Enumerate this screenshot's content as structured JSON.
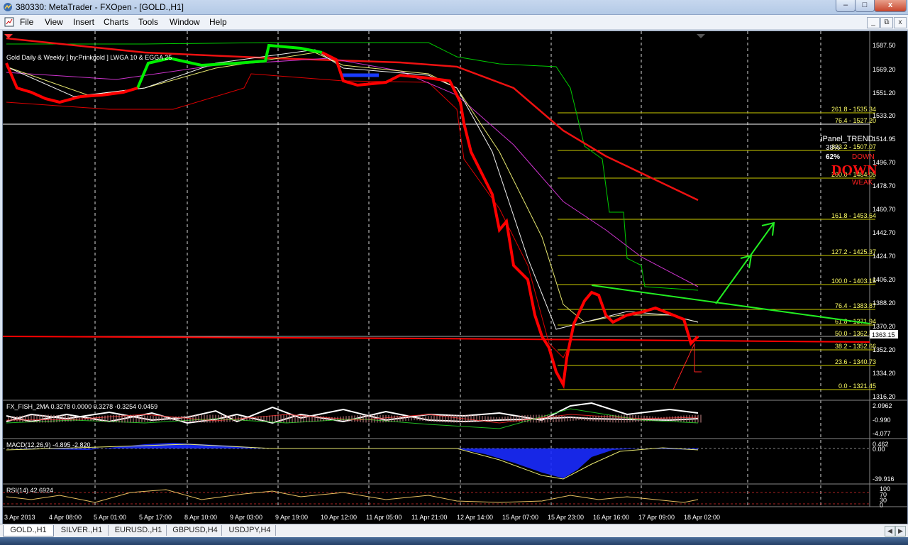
{
  "window": {
    "title": "380330: MetaTrader - FXOpen - [GOLD.,H1]",
    "min_label": "–",
    "max_label": "□",
    "close_label": "x",
    "mdi_min": "_",
    "mdi_restore": "⧉",
    "mdi_close": "x"
  },
  "menu": [
    "File",
    "View",
    "Insert",
    "Charts",
    "Tools",
    "Window",
    "Help"
  ],
  "chart": {
    "indicator_label": "Gold Daily & Weekly [ by:Prinkgold ] LWGA 10 & EGGA 25",
    "current_price": "1363.15",
    "price_axis": [
      "1587.50",
      "1569.20",
      "1551.20",
      "1533.20",
      "1514.95",
      "1496.70",
      "1478.70",
      "1460.70",
      "1442.70",
      "1424.70",
      "1406.20",
      "1388.20",
      "1370.20",
      "1352.20",
      "1334.20",
      "1316.20"
    ],
    "fib_levels": [
      "261.8 - 1535.34",
      "76.4 - 1527.20",
      "323.2 - 1507.07",
      "200.0 - 1484.05",
      "161.8 - 1453.64",
      "127.2 - 1425.37",
      "100.0 - 1403.15",
      "76.4 - 1383.87",
      "61.8 - 1371.94",
      "50.0 - 1362.30",
      "38.2 - 1352.66",
      "23.6 - 1340.73",
      "0.0 - 1321.45"
    ],
    "ipanel": {
      "title": "iPanel_TREND",
      "pct1": "38%",
      "pct2": "62%",
      "dir1": "DOWN",
      "big": "DOWN",
      "strength": "WEAK"
    },
    "fish": {
      "label": "FX_FISH_2MA 0.3278 0.0000 0.3278 -0.3254 0.0459",
      "axis": [
        "2.0962",
        "-0.990",
        "-4.077"
      ]
    },
    "macd": {
      "label": "MACD(12,26,9) -4.895 -2.820",
      "axis": [
        "0.462",
        "0.00",
        "-39.916"
      ]
    },
    "rsi": {
      "label": "RSI(14) 42.6924",
      "axis": [
        "100",
        "70",
        "30",
        "0"
      ]
    },
    "time_axis": [
      "3 Apr 2013",
      "4 Apr 08:00",
      "5 Apr 01:00",
      "5 Apr 17:00",
      "8 Apr 10:00",
      "9 Apr 03:00",
      "9 Apr 19:00",
      "10 Apr 12:00",
      "11 Apr 05:00",
      "11 Apr 21:00",
      "12 Apr 14:00",
      "15 Apr 07:00",
      "15 Apr 23:00",
      "16 Apr 16:00",
      "17 Apr 09:00",
      "18 Apr 02:00"
    ]
  },
  "tabs": [
    "GOLD.,H1",
    "SILVER.,H1",
    "EURUSD.,H1",
    "GBPUSD,H4",
    "USDJPY,H4"
  ],
  "colors": {
    "bg": "#000000",
    "candle": "#ff0000",
    "bull": "#00ff00",
    "grid": "#ffffff",
    "fib": "#ffff00",
    "trend": "#00ff00",
    "ma_red": "#ff0000",
    "ma_magenta": "#cc33cc",
    "ma_yellow": "#ffff66"
  }
}
